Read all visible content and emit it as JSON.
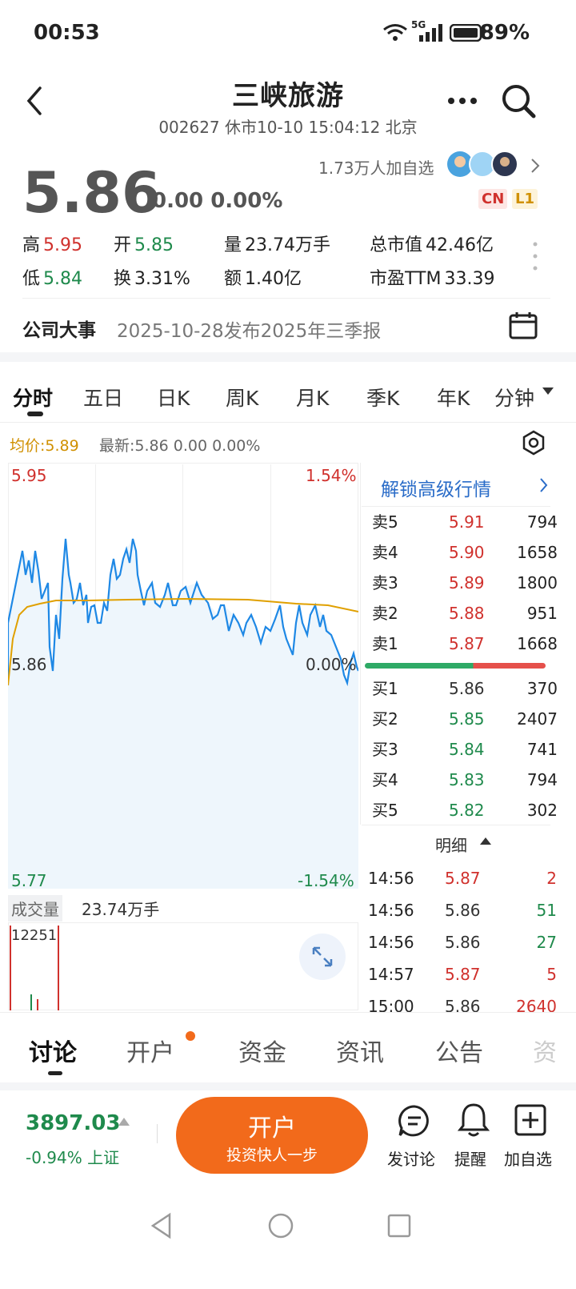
{
  "status_bar": {
    "time": "00:53",
    "battery": "89%",
    "network": "5G"
  },
  "header": {
    "title": "三峡旅游",
    "subtitle": "002627 休市10-10 15:04:12 北京"
  },
  "quote": {
    "price": "5.86",
    "change": "0.00 0.00%",
    "followers": "1.73万人加自选",
    "badges": [
      "CN",
      "L1"
    ],
    "stats": {
      "high_label": "高",
      "high": "5.95",
      "open_label": "开",
      "open": "5.85",
      "volume_label": "量",
      "volume": "23.74万手",
      "mcap_label": "总市值",
      "mcap": "42.46亿",
      "low_label": "低",
      "low": "5.84",
      "turnover_label": "换",
      "turnover": "3.31%",
      "amount_label": "额",
      "amount": "1.40亿",
      "pe_label": "市盈TTM",
      "pe": "33.39"
    }
  },
  "event": {
    "label": "公司大事",
    "text": "2025-10-28发布2025年三季报"
  },
  "chart_tabs": [
    "分时",
    "五日",
    "日K",
    "周K",
    "月K",
    "季K",
    "年K",
    "分钟"
  ],
  "chart_info": {
    "avg": "均价:5.89",
    "latest": "最新:5.86  0.00  0.00%"
  },
  "chart_labels": {
    "top_price": "5.95",
    "top_pct": "1.54%",
    "mid_price": "5.86",
    "mid_pct": "0.00%",
    "bot_price": "5.77",
    "bot_pct": "-1.54%"
  },
  "volume": {
    "label": "成交量",
    "value": "23.74万手",
    "max": "12251"
  },
  "orderbook": {
    "unlock": "解锁高级行情",
    "asks": [
      {
        "label": "卖5",
        "price": "5.91",
        "vol": "794"
      },
      {
        "label": "卖4",
        "price": "5.90",
        "vol": "1658"
      },
      {
        "label": "卖3",
        "price": "5.89",
        "vol": "1800"
      },
      {
        "label": "卖2",
        "price": "5.88",
        "vol": "951"
      },
      {
        "label": "卖1",
        "price": "5.87",
        "vol": "1668"
      }
    ],
    "bids": [
      {
        "label": "买1",
        "price": "5.86",
        "vol": "370"
      },
      {
        "label": "买2",
        "price": "5.85",
        "vol": "2407"
      },
      {
        "label": "买3",
        "price": "5.84",
        "vol": "741"
      },
      {
        "label": "买4",
        "price": "5.83",
        "vol": "794"
      },
      {
        "label": "买5",
        "price": "5.82",
        "vol": "302"
      }
    ],
    "detail_label": "明细"
  },
  "ticks": [
    {
      "time": "14:56",
      "price": "5.87",
      "vol": "2",
      "dir": "up"
    },
    {
      "time": "14:56",
      "price": "5.86",
      "vol": "51",
      "dir": "down"
    },
    {
      "time": "14:56",
      "price": "5.86",
      "vol": "27",
      "dir": "down"
    },
    {
      "time": "14:57",
      "price": "5.87",
      "vol": "5",
      "dir": "up"
    },
    {
      "time": "15:00",
      "price": "5.86",
      "vol": "2640",
      "dir": "up"
    }
  ],
  "bottom_tabs": [
    "讨论",
    "开户",
    "资金",
    "资讯",
    "公告",
    "资"
  ],
  "index": {
    "value": "3897.03",
    "change": "-0.94% 上证"
  },
  "open_account": {
    "main": "开户",
    "sub": "投资快人一步"
  },
  "actions": [
    "发讨论",
    "提醒",
    "加自选"
  ],
  "colors": {
    "up": "#d0312d",
    "down": "#1f8a4c",
    "accent": "#f26a1b",
    "line": "#1e88e5",
    "avg": "#e0a000"
  }
}
